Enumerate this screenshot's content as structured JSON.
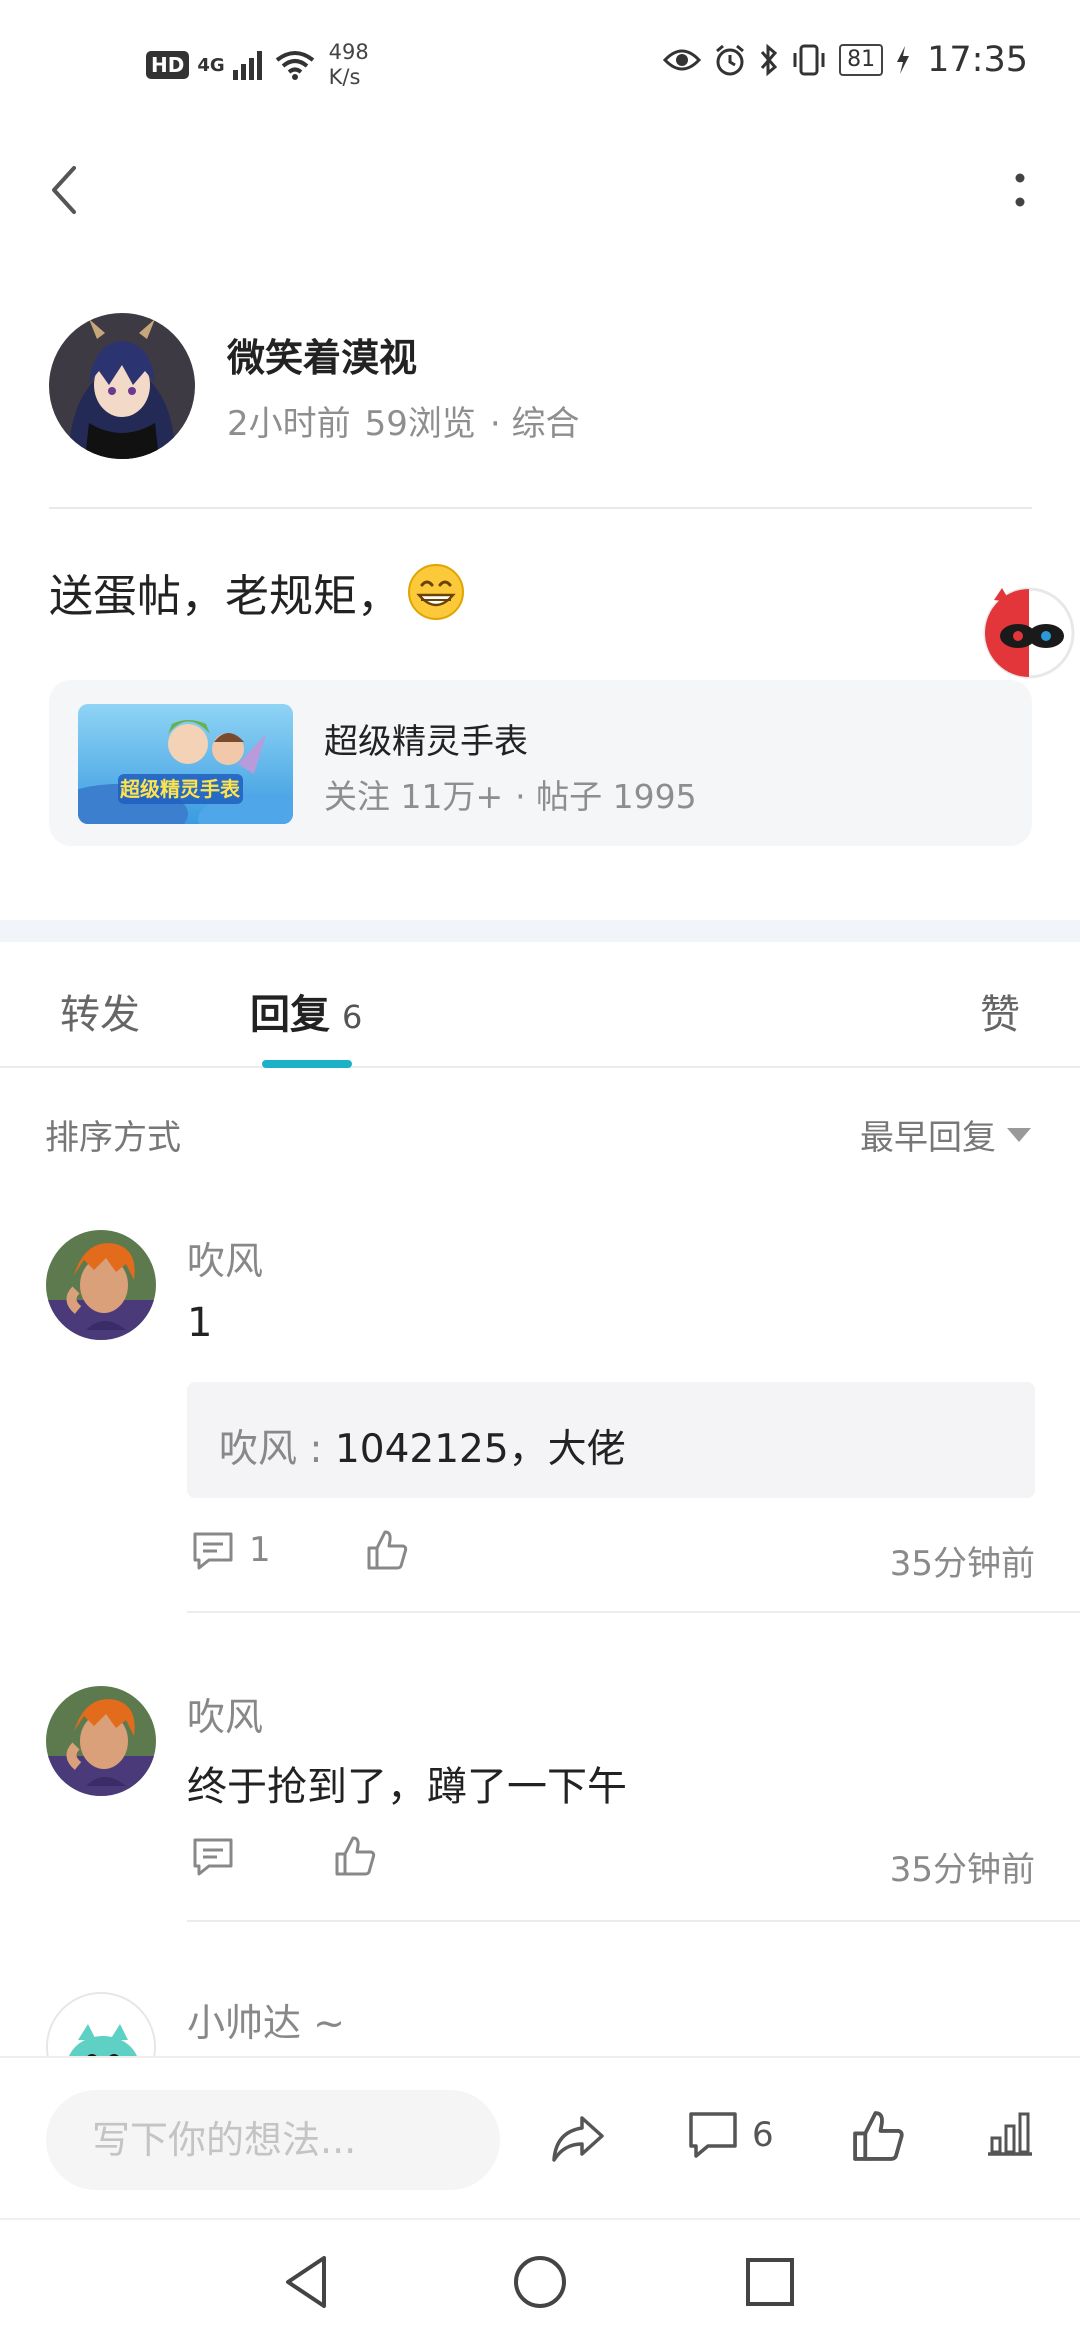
{
  "status_bar": {
    "hd": "HD",
    "network": "4G",
    "speed_value": "498",
    "speed_unit": "K/s",
    "battery": "81",
    "time": "17:35"
  },
  "post": {
    "author": "微笑着漠视",
    "time_ago": "2小时前",
    "views": "59浏览",
    "category": "· 综合",
    "content": "送蛋帖，老规矩，"
  },
  "topic": {
    "name": "超级精灵手表",
    "followers": "关注 11万+",
    "posts": "· 帖子 1995",
    "thumb_text": "超级精灵手表"
  },
  "tabs": {
    "forward": "转发",
    "reply": "回复",
    "reply_count": "6",
    "like": "赞"
  },
  "sort": {
    "label": "排序方式",
    "value": "最早回复"
  },
  "comments": [
    {
      "name": "吹风",
      "text": "1",
      "quote_name": "吹风 : ",
      "quote_text": "1042125，大佬",
      "reply_count": "1",
      "time": "35分钟前"
    },
    {
      "name": "吹风",
      "text": "终于抢到了，蹲了一下午",
      "time": "35分钟前"
    },
    {
      "name": "小帅达 ~"
    }
  ],
  "bottom_bar": {
    "placeholder": "写下你的想法...",
    "comment_count": "6"
  },
  "colors": {
    "accent": "#1bb2c8",
    "muted_text": "#888888",
    "section_gap": "#f1f4f8"
  }
}
